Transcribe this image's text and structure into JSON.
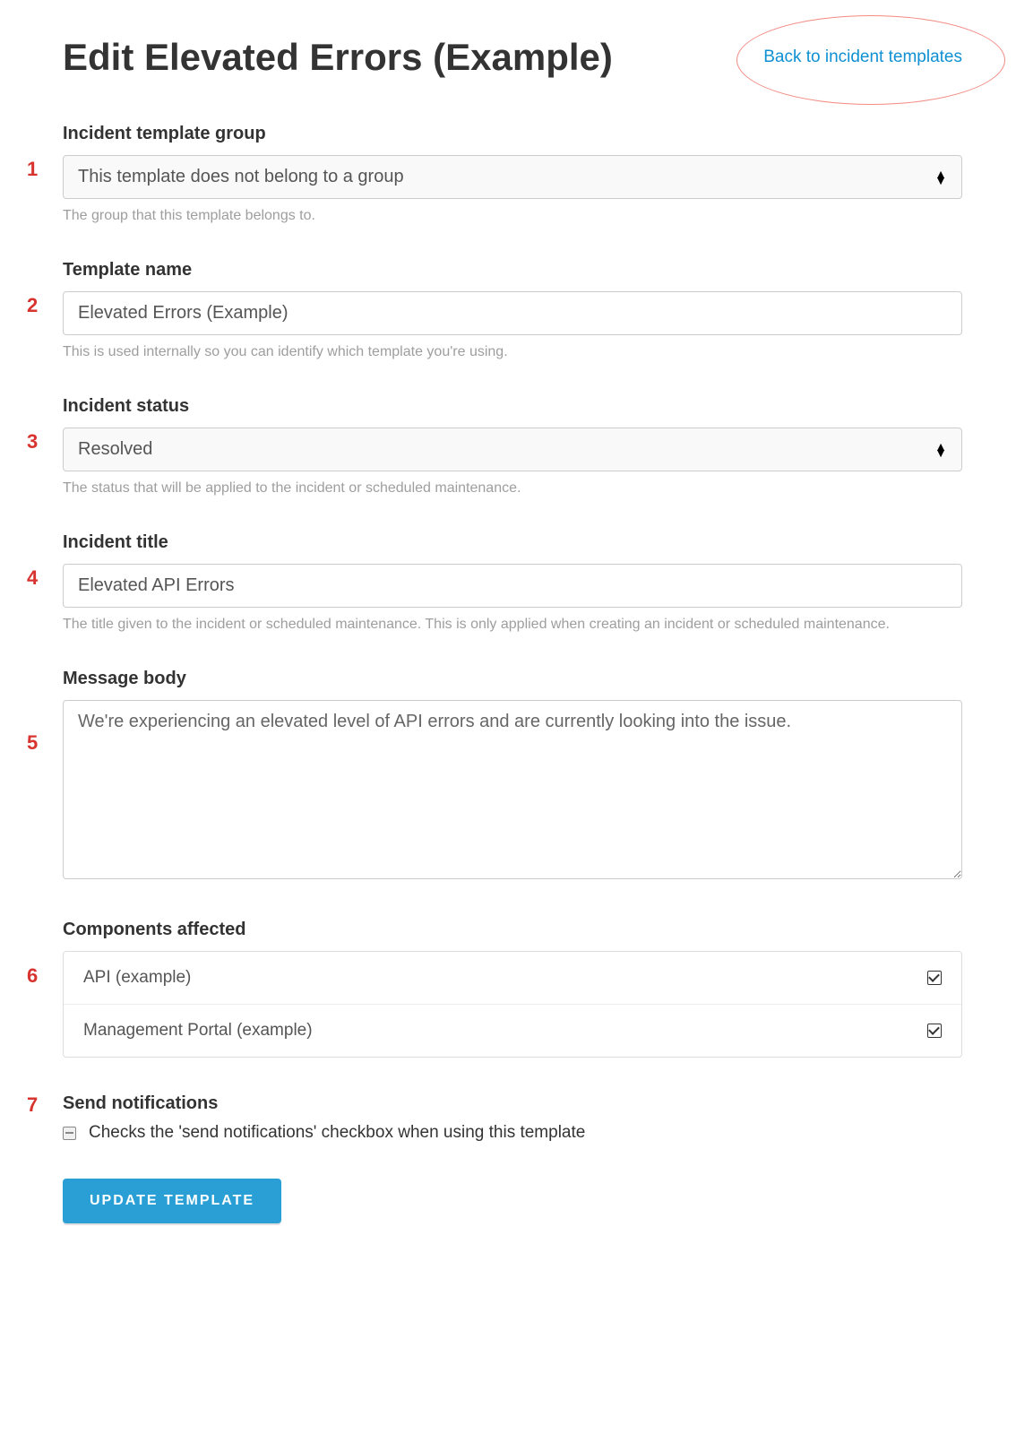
{
  "header": {
    "title": "Edit Elevated Errors (Example)",
    "back_link": "Back to incident templates"
  },
  "steps": [
    "1",
    "2",
    "3",
    "4",
    "5",
    "6",
    "7"
  ],
  "fields": {
    "group": {
      "label": "Incident template group",
      "value": "This template does not belong to a group",
      "help": "The group that this template belongs to."
    },
    "template_name": {
      "label": "Template name",
      "value": "Elevated Errors (Example)",
      "help": "This is used internally so you can identify which template you're using."
    },
    "status": {
      "label": "Incident status",
      "value": "Resolved",
      "help": "The status that will be applied to the incident or scheduled maintenance."
    },
    "title": {
      "label": "Incident title",
      "value": "Elevated API Errors",
      "help": "The title given to the incident or scheduled maintenance. This is only applied when creating an incident or scheduled maintenance."
    },
    "body": {
      "label": "Message body",
      "value": "We're experiencing an elevated level of API errors and are currently looking into the issue."
    },
    "components": {
      "label": "Components affected",
      "items": [
        {
          "name": "API (example)",
          "checked": true
        },
        {
          "name": "Management Portal (example)",
          "checked": true
        }
      ]
    },
    "notifications": {
      "label": "Send notifications",
      "desc": "Checks the 'send notifications' checkbox when using this template",
      "checked": false
    }
  },
  "submit": {
    "label": "UPDATE TEMPLATE"
  }
}
